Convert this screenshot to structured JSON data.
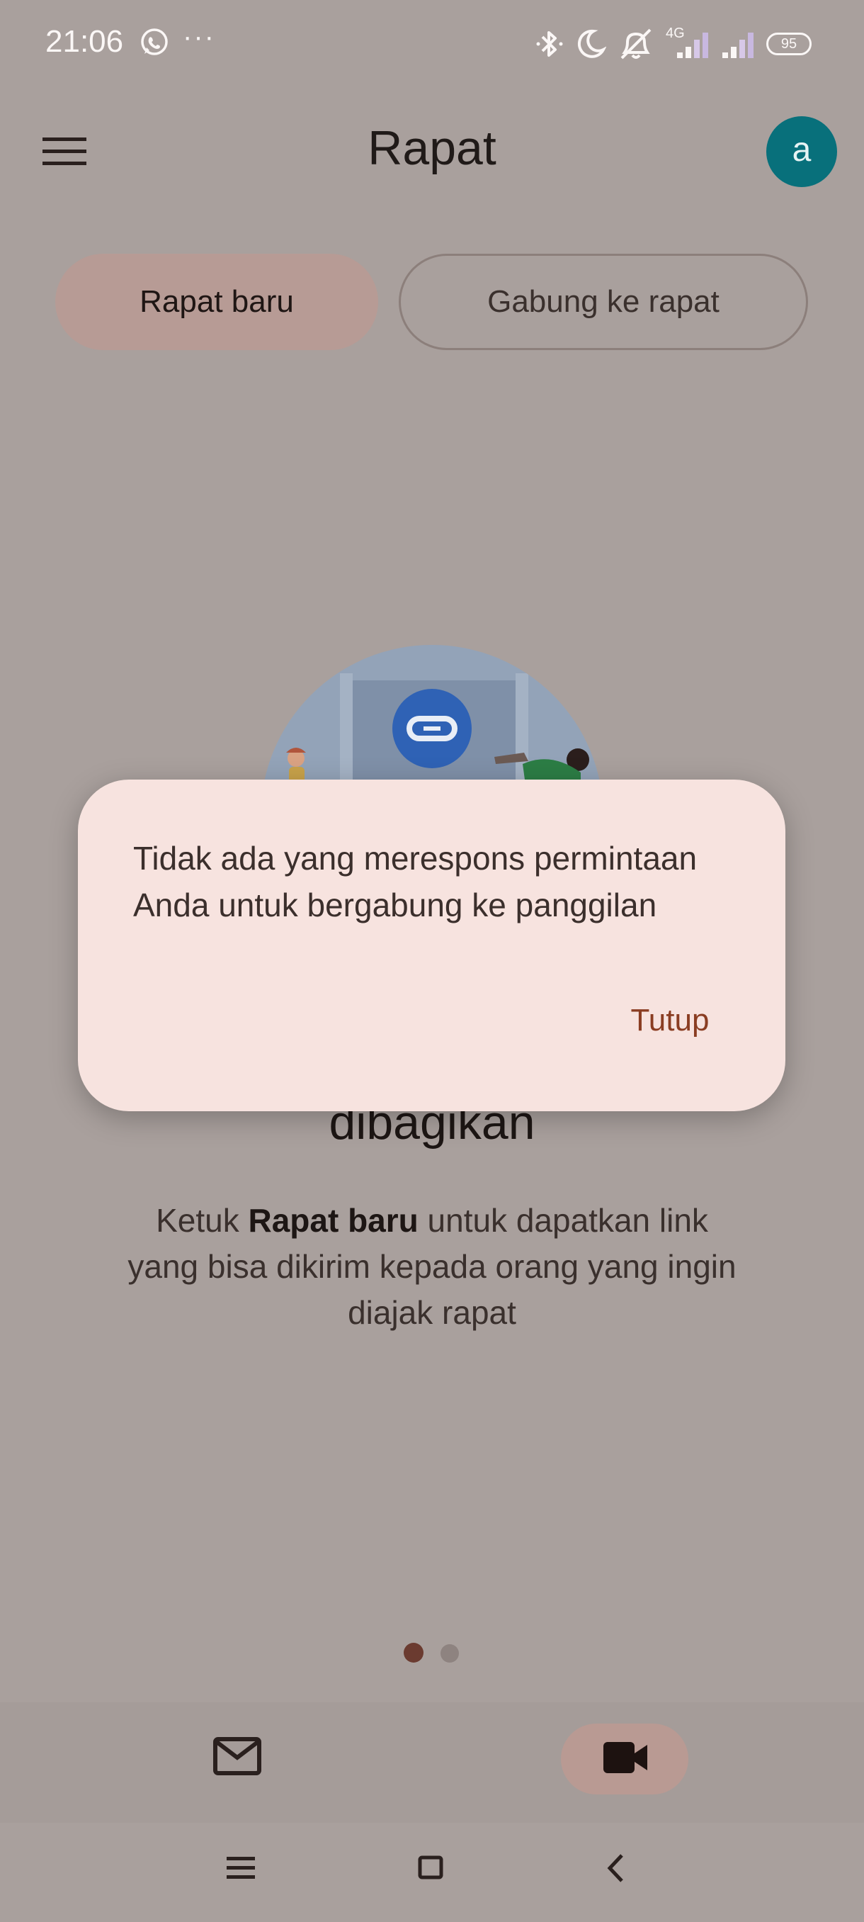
{
  "status_bar": {
    "time": "21:06",
    "more_indicator": "···",
    "network_label": "4G",
    "battery": "95",
    "icons": [
      "whatsapp-icon",
      "bluetooth-icon",
      "moon-icon",
      "alarm-off-icon",
      "signal-icon",
      "signal-icon",
      "battery-icon"
    ]
  },
  "header": {
    "title": "Rapat",
    "avatar_initial": "a"
  },
  "actions": {
    "new_meeting": "Rapat baru",
    "join_meeting": "Gabung ke rapat"
  },
  "content": {
    "headline": "dibagikan",
    "desc_prefix": "Ketuk ",
    "desc_bold": "Rapat baru",
    "desc_suffix": " untuk dapatkan link yang bisa dikirim kepada orang yang ingin diajak rapat"
  },
  "pager": {
    "count": 2,
    "active_index": 0
  },
  "bottom_nav": {
    "items": [
      "mail-icon",
      "video-icon"
    ],
    "active": "video-icon"
  },
  "dialog": {
    "message": "Tidak ada yang merespons permintaan Anda untuk bergabung ke panggilan",
    "close_label": "Tutup"
  },
  "colors": {
    "scrim": "#a9a09d",
    "accent": "#8a3d22",
    "avatar_bg": "#08707b",
    "dialog_bg": "#f7e3df",
    "primary_button_bg": "#b79b95"
  }
}
